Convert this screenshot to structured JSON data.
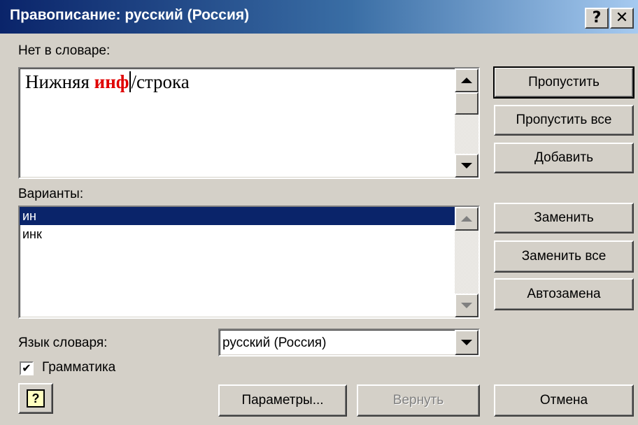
{
  "window": {
    "title": "Правописание: русский (Россия)",
    "help_caption": "?",
    "close_caption": "X"
  },
  "not_in_dictionary": {
    "label": "Нет в словаре:",
    "text_before": "Нижняя ",
    "error_word": "инф",
    "text_after": "/строка"
  },
  "suggestions": {
    "label": "Варианты:",
    "items": [
      "ин",
      "инк"
    ],
    "selected_index": 0
  },
  "dictionary_language": {
    "label": "Язык словаря:",
    "value": "русский (Россия)"
  },
  "grammar": {
    "label": "Грамматика",
    "checked": true
  },
  "buttons": {
    "ignore": "Пропустить",
    "ignore_all": "Пропустить все",
    "add": "Добавить",
    "change": "Заменить",
    "change_all": "Заменить все",
    "autocorrect": "Автозамена",
    "options": "Параметры...",
    "undo": "Вернуть",
    "cancel": "Отмена"
  },
  "colors": {
    "title_bar_start": "#0a246a",
    "error_word": "#e00000",
    "selection": "#0a246a"
  }
}
